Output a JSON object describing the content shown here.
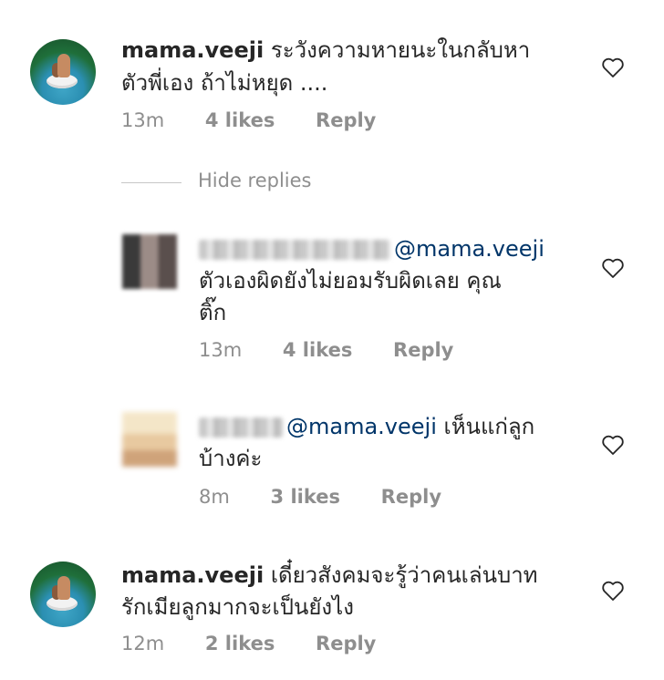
{
  "comments": [
    {
      "username": "mama.veeji",
      "text_line1": "ระวังความหายนะในกลับหา",
      "text_line2": "ตัวพี่เอง ถ้าไม่หยุด ....",
      "time": "13m",
      "likes": "4 likes",
      "reply": "Reply",
      "avatar": "pool-photo"
    },
    {
      "mention": "@mama.veeji",
      "text_line1": "ตัวเองผิดยังไม่ยอมรับผิดเลย คุณ",
      "text_line2": "ติ๊ก",
      "time": "13m",
      "likes": "4 likes",
      "reply": "Reply",
      "avatar": "blurred-photo"
    },
    {
      "mention": "@mama.veeji",
      "text_after_mention": "เห็นแก่ลูก",
      "text_line2": "บ้างค่ะ",
      "time": "8m",
      "likes": "3 likes",
      "reply": "Reply",
      "avatar": "blurred-photo"
    },
    {
      "username": "mama.veeji",
      "text_line1": "เดี๋ยวสังคมจะรู้ว่าคนเล่นบาท",
      "text_line2": "รักเมียลูกมากจะเป็นยังไง",
      "time": "12m",
      "likes": "2 likes",
      "reply": "Reply",
      "avatar": "pool-photo"
    }
  ],
  "hide_replies": "Hide replies",
  "icons": {
    "like": "heart-outline-icon"
  },
  "colors": {
    "text": "#262626",
    "meta": "#8e8e8e",
    "mention": "#003569"
  }
}
